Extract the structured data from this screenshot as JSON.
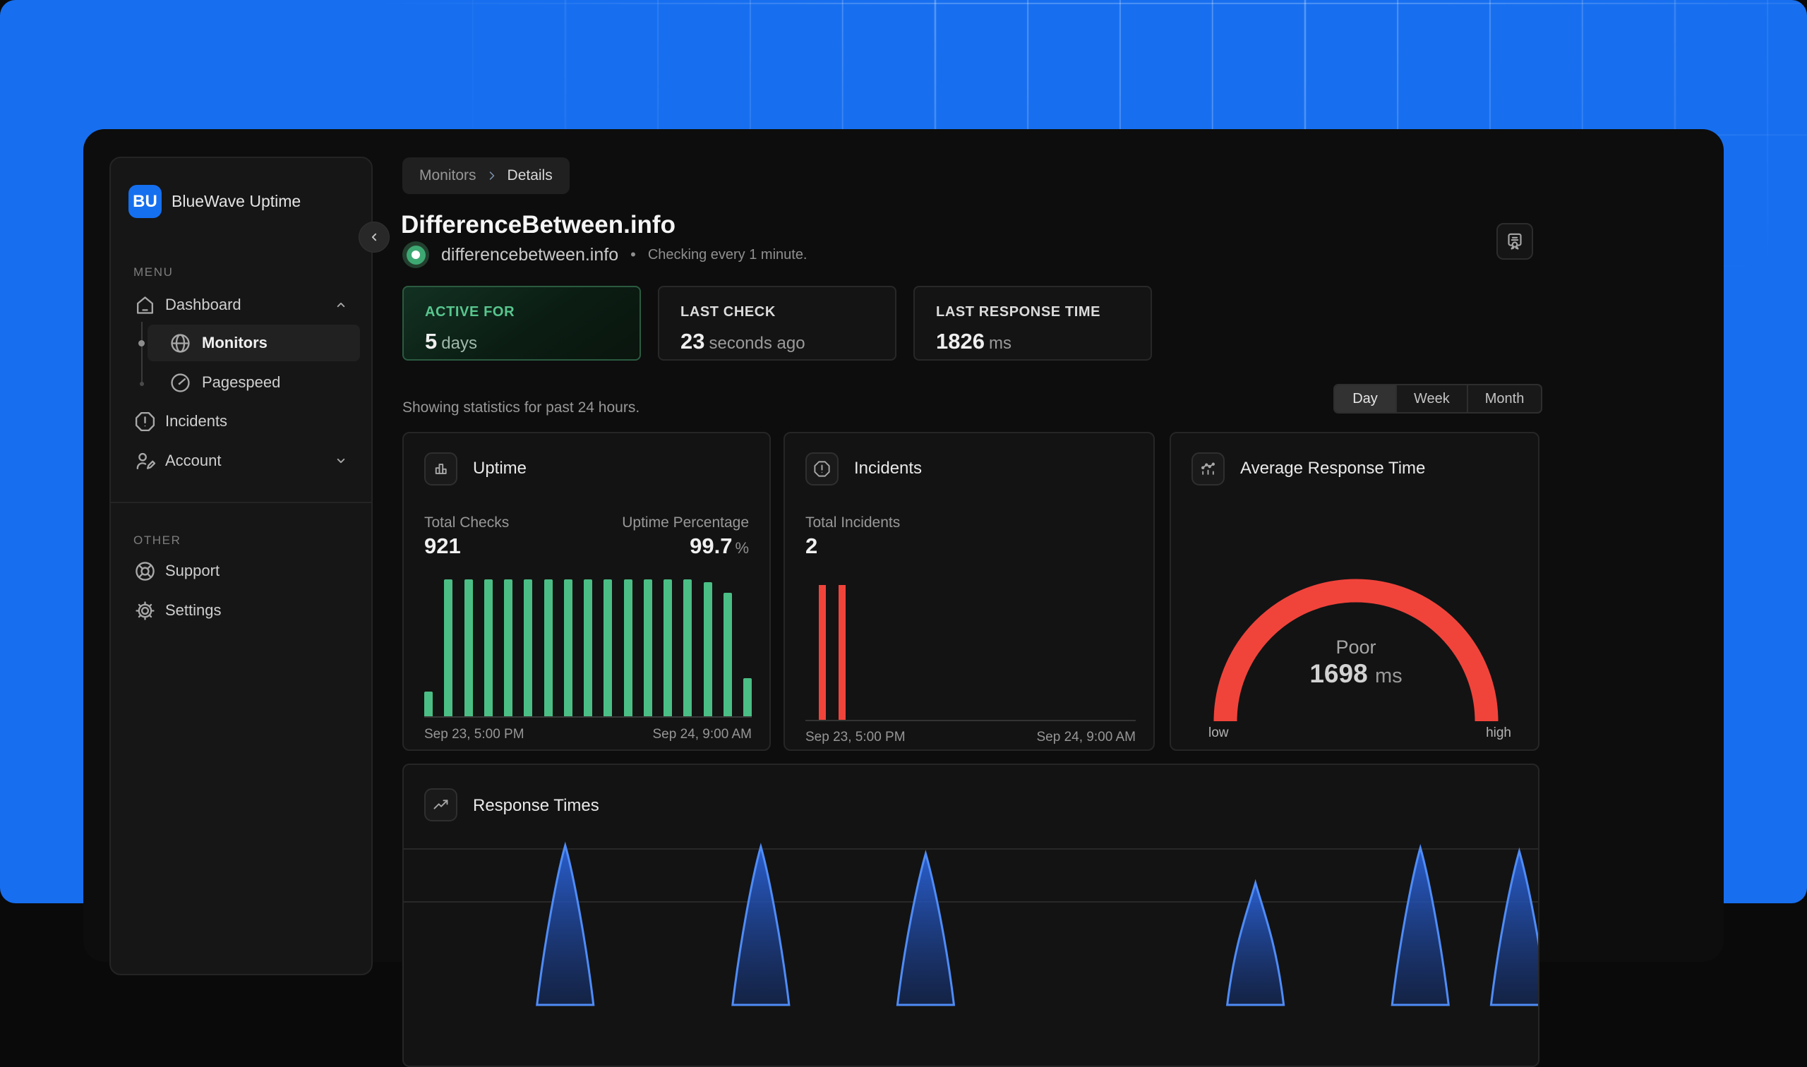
{
  "brand": {
    "logo_text": "BU",
    "name": "BlueWave Uptime"
  },
  "colors": {
    "brand_blue": "#1570EF",
    "green": "#4ABE85",
    "red": "#F0443B",
    "chart_blue_stroke": "#4F8CF7",
    "chart_blue_fill": "#2757B9"
  },
  "sidebar": {
    "menu_label": "MENU",
    "other_label": "OTHER",
    "items": [
      {
        "label": "Dashboard"
      },
      {
        "label": "Monitors"
      },
      {
        "label": "Pagespeed"
      },
      {
        "label": "Incidents"
      },
      {
        "label": "Account"
      },
      {
        "label": "Support"
      },
      {
        "label": "Settings"
      }
    ]
  },
  "breadcrumb": {
    "items": [
      "Monitors",
      "Details"
    ]
  },
  "header": {
    "title": "DifferenceBetween.info",
    "monitor_url": "differencebetween.info",
    "separator": "•",
    "checking_note": "Checking every 1 minute."
  },
  "stat_cards": [
    {
      "label": "ACTIVE FOR",
      "value": "5",
      "unit": "days"
    },
    {
      "label": "LAST CHECK",
      "value": "23",
      "unit": "seconds ago"
    },
    {
      "label": "LAST RESPONSE TIME",
      "value": "1826",
      "unit": "ms"
    }
  ],
  "stats_note": "Showing statistics for past 24 hours.",
  "range_toggle": {
    "options": [
      "Day",
      "Week",
      "Month"
    ],
    "selected": "Day"
  },
  "uptime_card": {
    "title": "Uptime",
    "total_checks_label": "Total Checks",
    "total_checks": "921",
    "uptime_pct_label": "Uptime Percentage",
    "uptime_pct": "99.7",
    "uptime_pct_unit": "%",
    "x_start": "Sep 23, 5:00 PM",
    "x_end": "Sep 24, 9:00 AM"
  },
  "incidents_card": {
    "title": "Incidents",
    "total_label": "Total Incidents",
    "total": "2",
    "x_start": "Sep 23, 5:00 PM",
    "x_end": "Sep 24, 9:00 AM"
  },
  "avg_response_card": {
    "title": "Average Response Time",
    "status": "Poor",
    "value": "1698",
    "unit": "ms",
    "low": "low",
    "high": "high"
  },
  "response_times_card": {
    "title": "Response Times"
  },
  "chart_data": [
    {
      "type": "bar",
      "title": "Uptime",
      "x_start_label": "Sep 23, 5:00 PM",
      "x_end_label": "Sep 24, 9:00 AM",
      "values": [
        0.18,
        1,
        1,
        1,
        1,
        1,
        1,
        1,
        1,
        1,
        1,
        1,
        1,
        1,
        0.98,
        0.9,
        0.28
      ],
      "ylim": [
        0,
        1
      ],
      "color": "#4ABE85"
    },
    {
      "type": "bar",
      "title": "Incidents",
      "x_start_label": "Sep 23, 5:00 PM",
      "x_end_label": "Sep 24, 9:00 AM",
      "values": [
        1,
        1
      ],
      "positions": [
        0.04,
        0.1
      ],
      "color": "#F0443B"
    },
    {
      "type": "gauge",
      "title": "Average Response Time",
      "status": "Poor",
      "value": 1698,
      "unit": "ms",
      "range_labels": [
        "low",
        "high"
      ],
      "color": "#F0443B"
    },
    {
      "type": "area",
      "title": "Response Times",
      "spikes": [
        {
          "x": 0.142,
          "peak": 1.0
        },
        {
          "x": 0.314,
          "peak": 0.99
        },
        {
          "x": 0.459,
          "peak": 0.93
        },
        {
          "x": 0.749,
          "peak": 0.68
        },
        {
          "x": 0.894,
          "peak": 0.98
        },
        {
          "x": 0.981,
          "peak": 0.95
        }
      ],
      "stroke": "#4F8CF7",
      "fill": "#2757B9"
    }
  ]
}
